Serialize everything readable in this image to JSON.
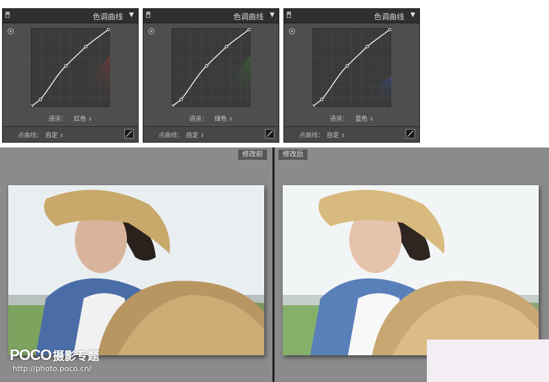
{
  "tone_curve_panels": [
    {
      "title": "色调曲线",
      "channel_label": "通道：",
      "channel_value": "红色",
      "point_curve_label": "点曲线：",
      "point_curve_value": "自定",
      "tint_color": "#9a3a36"
    },
    {
      "title": "色调曲线",
      "channel_label": "通道：",
      "channel_value": "绿色",
      "point_curve_label": "点曲线：",
      "point_curve_value": "自定",
      "tint_color": "#3f7d3b"
    },
    {
      "title": "色调曲线",
      "channel_label": "通道：",
      "channel_value": "蓝色",
      "point_curve_label": "点曲线：",
      "point_curve_value": "自定",
      "tint_color": "#3c4f92"
    }
  ],
  "viewer": {
    "before_label": "修改前",
    "after_label": "修改后"
  },
  "watermark": {
    "logo": "POCO",
    "brand": "摄影专题",
    "url": "http://photo.poco.cn/"
  },
  "icons": {
    "collapse": "triangle-down-icon",
    "target": "target-adjust-icon",
    "edit_point_curve": "edit-point-curve-icon"
  }
}
